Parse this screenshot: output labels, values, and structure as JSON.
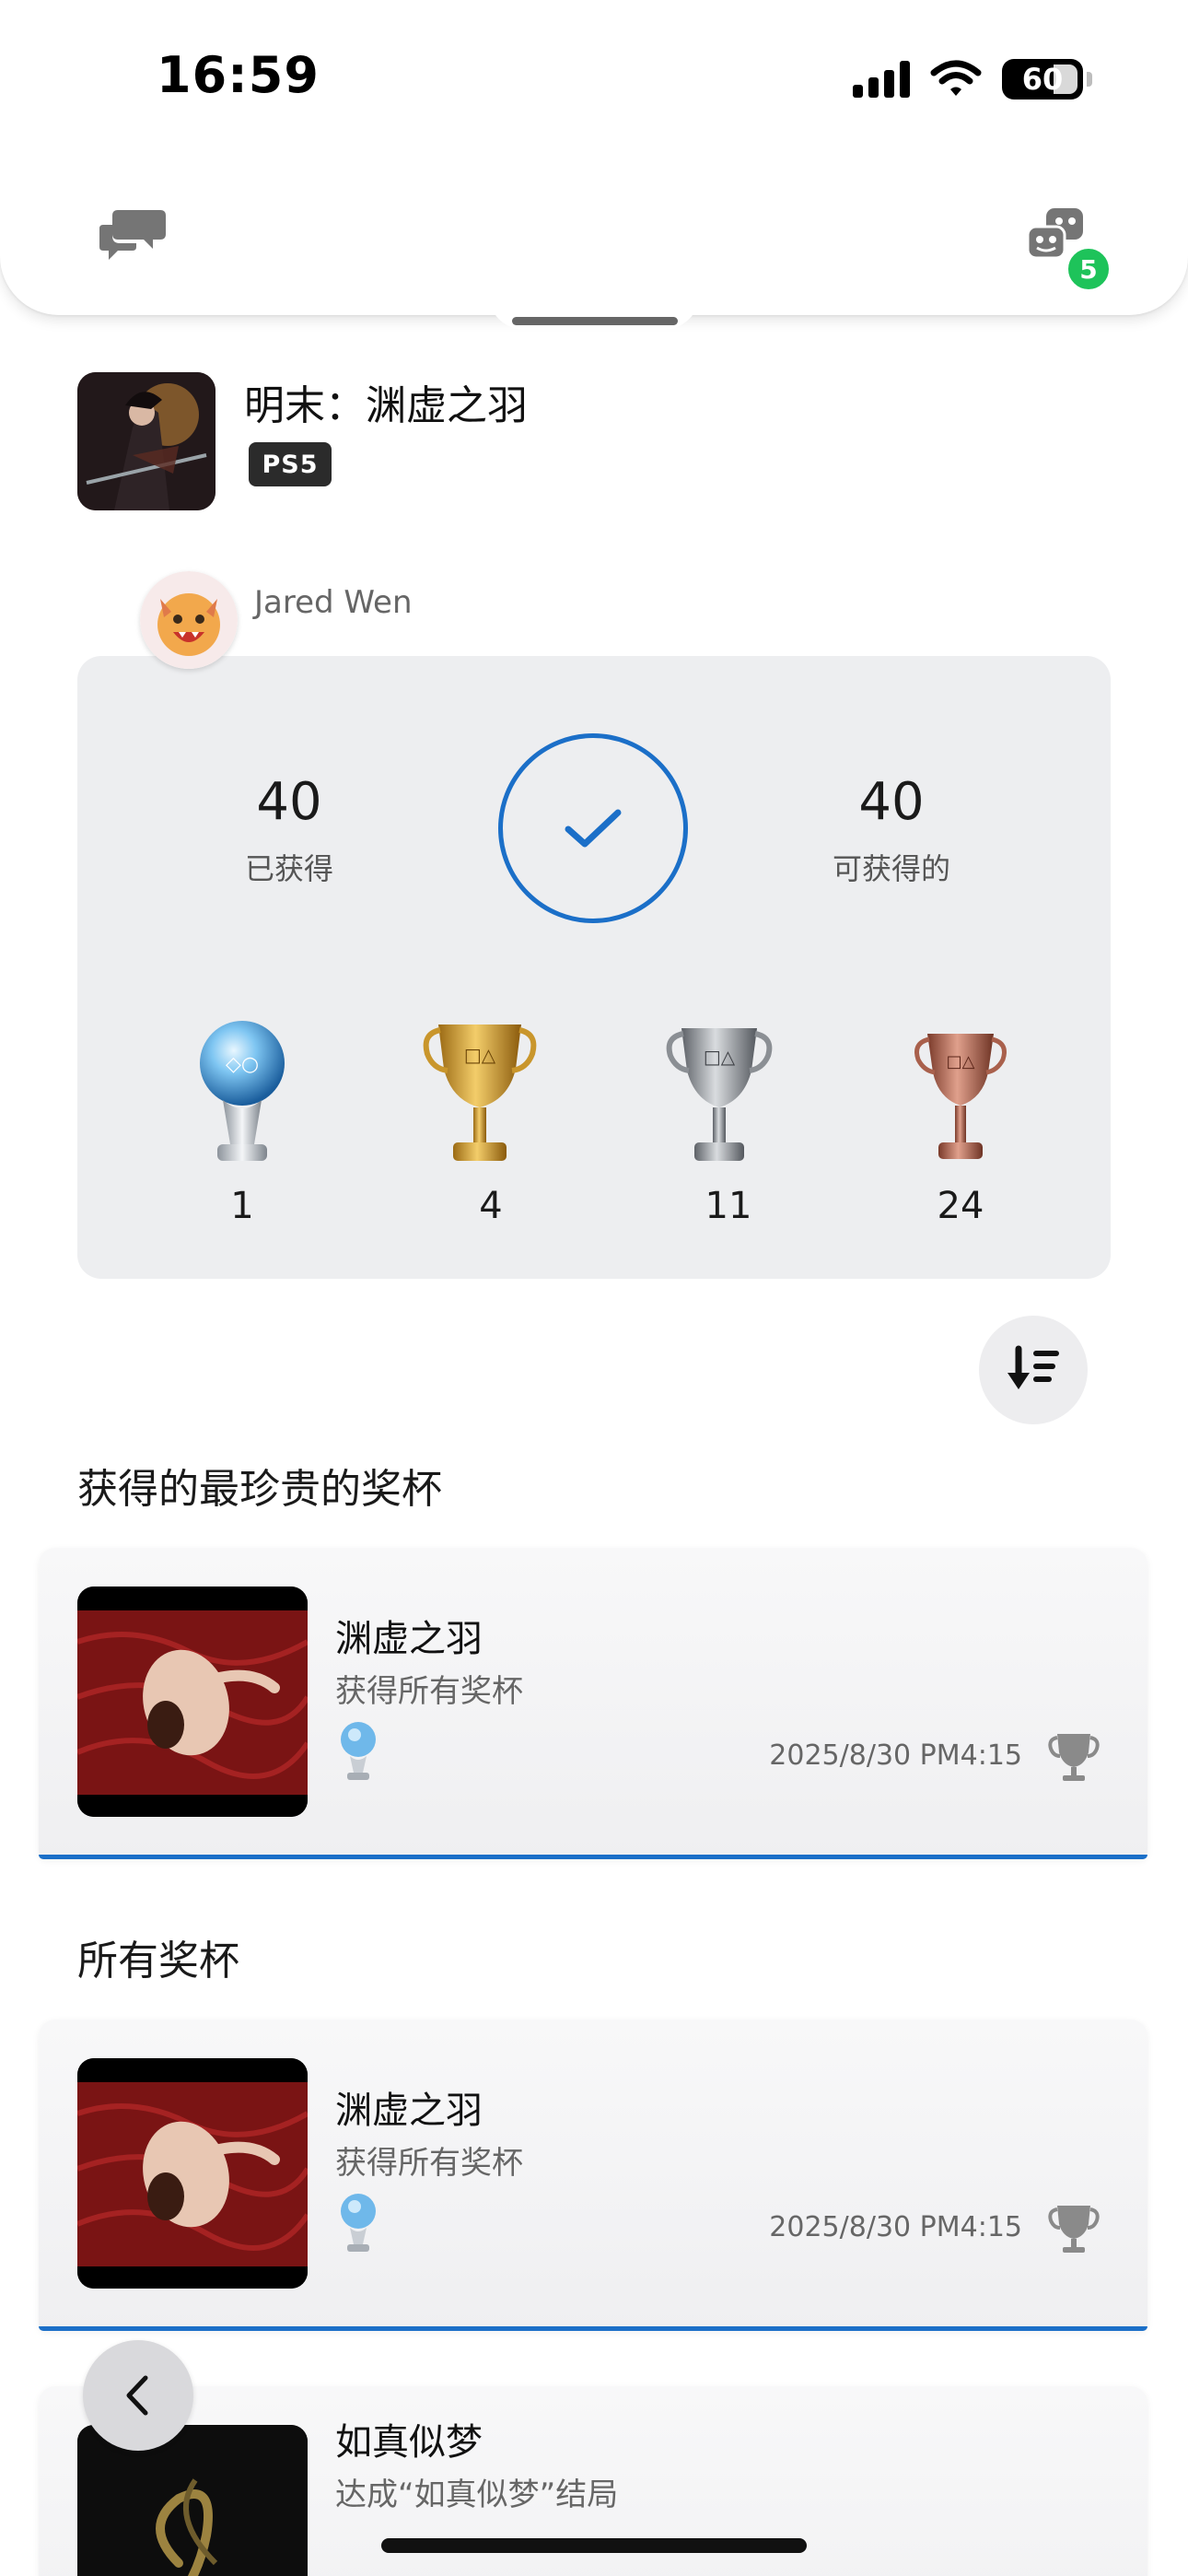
{
  "status_bar": {
    "time": "16:59",
    "battery": "60"
  },
  "header": {
    "notification_count": "5",
    "left_icon": "chat-bubbles-icon",
    "right_icon": "friends-icon"
  },
  "game": {
    "title": "明末：渊虚之羽",
    "platform": "PS5"
  },
  "user": {
    "name": "Jared Wen"
  },
  "summary": {
    "earned_value": "40",
    "earned_label": "已获得",
    "available_value": "40",
    "available_label": "可获得的",
    "trophies": [
      {
        "type": "platinum",
        "count": "1"
      },
      {
        "type": "gold",
        "count": "4"
      },
      {
        "type": "silver",
        "count": "11"
      },
      {
        "type": "bronze",
        "count": "24"
      }
    ]
  },
  "sections": {
    "rarest_title": "获得的最珍贵的奖杯",
    "all_title": "所有奖杯"
  },
  "rarest_trophy": {
    "name": "渊虚之羽",
    "description": "获得所有奖杯",
    "date": "2025/8/30  PM4:15",
    "grade": "platinum"
  },
  "all_trophies": [
    {
      "name": "渊虚之羽",
      "description": "获得所有奖杯",
      "date": "2025/8/30  PM4:15",
      "grade": "platinum"
    },
    {
      "name": "如真似梦",
      "description": "达成“如真似梦”结局",
      "date": "",
      "grade": "gold"
    }
  ],
  "colors": {
    "accent_blue": "#1b6fc8",
    "badge_green": "#1ec35a",
    "card_bg": "#edeef0"
  }
}
